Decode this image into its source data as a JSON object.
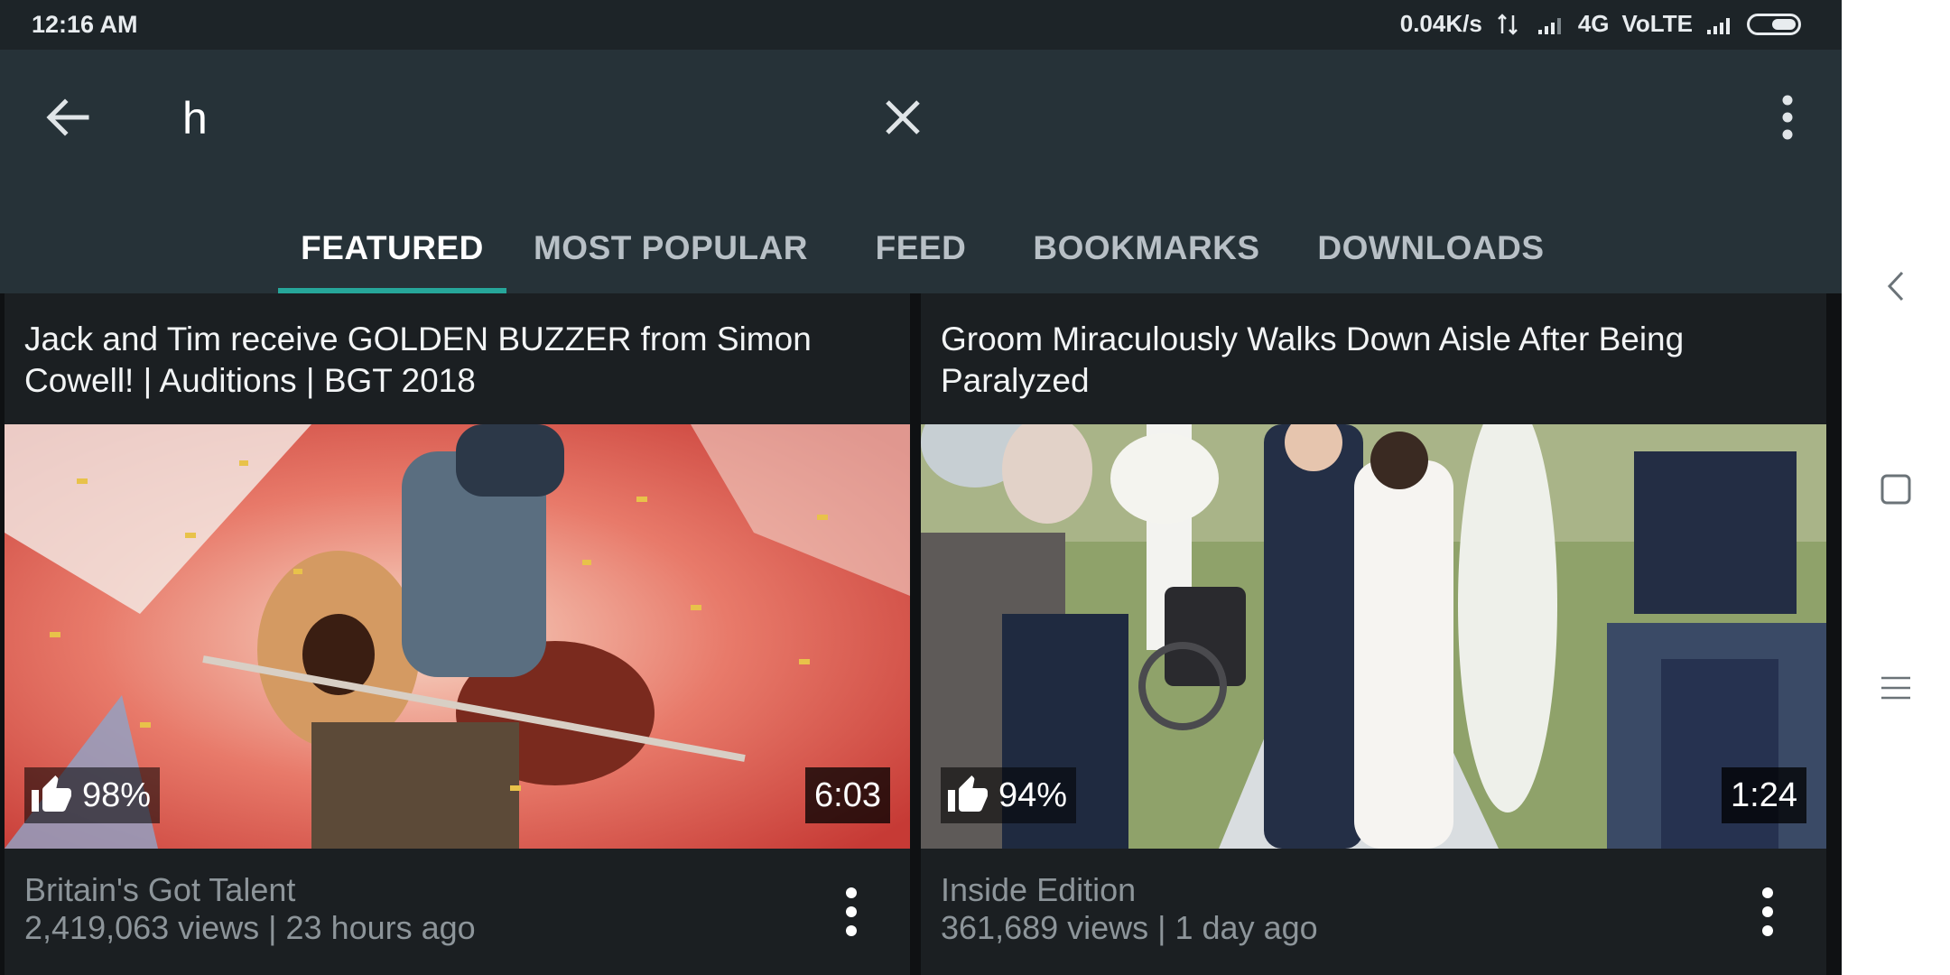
{
  "status_bar": {
    "time": "12:16 AM",
    "net_speed": "0.04K/s",
    "network": "4G",
    "volte": "VoLTE"
  },
  "search": {
    "query": "h"
  },
  "tabs": [
    {
      "label": "FEATURED",
      "active": true
    },
    {
      "label": "MOST POPULAR",
      "active": false
    },
    {
      "label": "FEED",
      "active": false
    },
    {
      "label": "BOOKMARKS",
      "active": false
    },
    {
      "label": "DOWNLOADS",
      "active": false
    }
  ],
  "videos": [
    {
      "title": "Jack and Tim receive GOLDEN BUZZER from Simon Cowell! | Auditions | BGT 2018",
      "likes": "98%",
      "duration": "6:03",
      "channel": "Britain's Got Talent",
      "meta": "2,419,063 views  |  23 hours ago"
    },
    {
      "title": "Groom Miraculously Walks Down Aisle After Being Paralyzed",
      "likes": "94%",
      "duration": "1:24",
      "channel": "Inside Edition",
      "meta": "361,689 views  |  1 day ago"
    }
  ],
  "colors": {
    "toolbar": "#263238",
    "accent": "#26a69a",
    "background": "#0f1113"
  },
  "icons": [
    "back-arrow-icon",
    "close-icon",
    "more-vert-icon",
    "thumb-up-icon",
    "nav-back-icon",
    "nav-home-icon",
    "nav-menu-icon"
  ]
}
